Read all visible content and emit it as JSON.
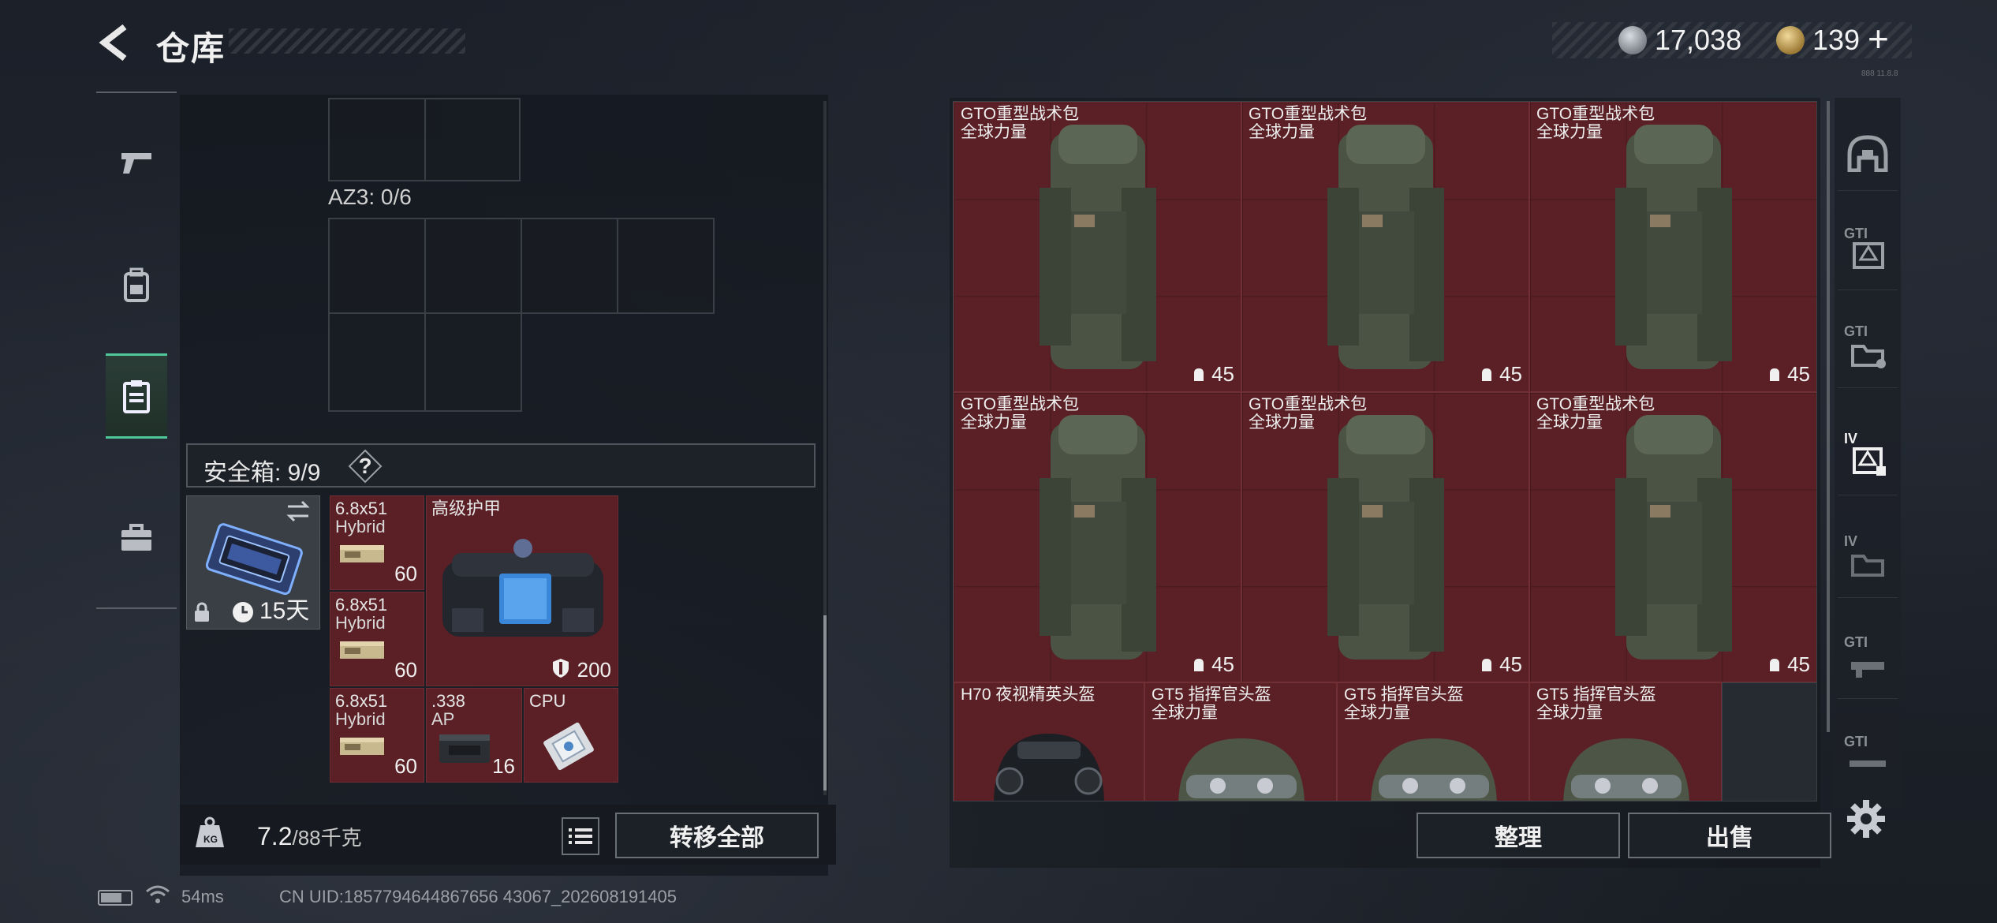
{
  "header": {
    "title": "仓库",
    "currency_silver": "17,038",
    "currency_gold": "139",
    "currency_plus": "+",
    "version": "888 11.8.8"
  },
  "left_tabs": [
    {
      "name": "pistol-icon"
    },
    {
      "name": "backpack-icon"
    },
    {
      "name": "clipboard-icon",
      "active": true
    },
    {
      "name": "briefcase-icon"
    }
  ],
  "container": {
    "az3_label": "AZ3: 0/6"
  },
  "safe_box": {
    "label": "安全箱: 9/9",
    "help": "?",
    "case_time": "15天",
    "items": [
      {
        "name": "6.8x51",
        "sub": "Hybrid",
        "count": "60"
      },
      {
        "name": "6.8x51",
        "sub": "Hybrid",
        "count": "60"
      },
      {
        "name": "6.8x51",
        "sub": "Hybrid",
        "count": "60"
      },
      {
        "name": "高级护甲",
        "count": "200"
      },
      {
        "name": ".338",
        "sub": "AP",
        "count": "16"
      },
      {
        "name": "CPU"
      }
    ]
  },
  "weight": {
    "current": "7.2",
    "max": "/88千克"
  },
  "buttons": {
    "transfer_all": "转移全部",
    "sort": "整理",
    "sell": "出售"
  },
  "status": {
    "ping": "54ms",
    "uid": "CN UID:1857794644867656 43067_202608191405"
  },
  "stash_items": [
    {
      "name": "GTO重型战术包",
      "sub": "全球力量",
      "cap": "45"
    },
    {
      "name": "GTO重型战术包",
      "sub": "全球力量",
      "cap": "45"
    },
    {
      "name": "GTO重型战术包",
      "sub": "全球力量",
      "cap": "45"
    },
    {
      "name": "GTO重型战术包",
      "sub": "全球力量",
      "cap": "45"
    },
    {
      "name": "GTO重型战术包",
      "sub": "全球力量",
      "cap": "45"
    },
    {
      "name": "GTO重型战术包",
      "sub": "全球力量",
      "cap": "45"
    },
    {
      "name": "H70 夜视精英头盔",
      "sub": ""
    },
    {
      "name": "GT5 指挥官头盔",
      "sub": "全球力量"
    },
    {
      "name": "GT5 指挥官头盔",
      "sub": "全球力量"
    },
    {
      "name": "GT5 指挥官头盔",
      "sub": "全球力量"
    }
  ],
  "right_tabs": [
    {
      "name": "helmet-tab-icon",
      "label": ""
    },
    {
      "name": "gti-tab-icon",
      "label": "GTI"
    },
    {
      "name": "gti-folder-tab-icon",
      "label": "GTI"
    },
    {
      "name": "iv-tab-icon",
      "label": "IV",
      "active": true
    },
    {
      "name": "iv-folder-tab-icon",
      "label": "IV"
    },
    {
      "name": "gti-gun-tab-icon",
      "label": "GTI"
    },
    {
      "name": "gti-rifle-tab-icon",
      "label": "GTI"
    }
  ],
  "colors": {
    "accent_green": "#4fc79a",
    "item_maroon": "#5a2025",
    "panel_bg": "#14181e"
  }
}
